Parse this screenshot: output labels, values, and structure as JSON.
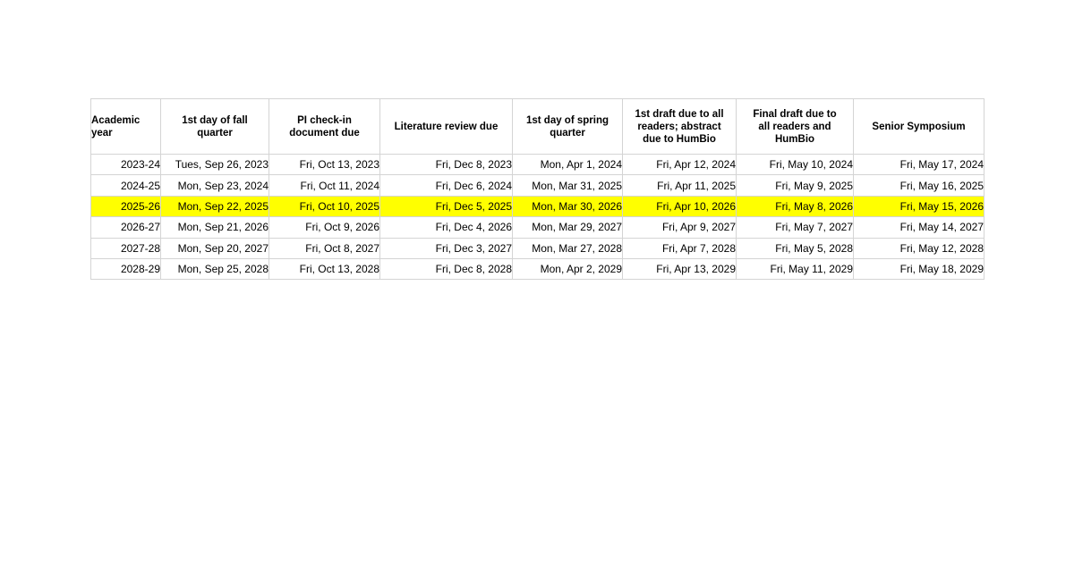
{
  "table": {
    "columns": [
      "Academic year",
      "1st day of fall quarter",
      "PI check-in document due",
      "Literature review due",
      "1st day of spring quarter",
      "1st draft due to all readers; abstract due to HumBio",
      "Final draft due to all readers and HumBio",
      "Senior Symposium"
    ],
    "header_lines": [
      [
        "Academic",
        "year"
      ],
      [
        "1st day of fall",
        "quarter"
      ],
      [
        "PI check-in",
        "document due"
      ],
      [
        "Literature review due"
      ],
      [
        "1st day of spring",
        "quarter"
      ],
      [
        "1st draft due to all",
        "readers; abstract",
        "due to HumBio"
      ],
      [
        "Final draft due to",
        "all readers and",
        "HumBio"
      ],
      [
        "Senior Symposium"
      ]
    ],
    "highlight_color": "#FFFF00",
    "highlighted_row_index": 2,
    "rows": [
      {
        "highlighted": false,
        "cells": [
          "2023-24",
          "Tues, Sep 26, 2023",
          "Fri, Oct 13, 2023",
          "Fri, Dec 8, 2023",
          "Mon, Apr 1, 2024",
          "Fri, Apr 12, 2024",
          "Fri, May 10, 2024",
          "Fri, May 17, 2024"
        ]
      },
      {
        "highlighted": false,
        "cells": [
          "2024-25",
          "Mon, Sep 23, 2024",
          "Fri, Oct 11, 2024",
          "Fri, Dec 6, 2024",
          "Mon, Mar 31, 2025",
          "Fri, Apr 11, 2025",
          "Fri, May 9, 2025",
          "Fri, May 16, 2025"
        ]
      },
      {
        "highlighted": true,
        "cells": [
          "2025-26",
          "Mon, Sep 22, 2025",
          "Fri, Oct 10, 2025",
          "Fri, Dec 5, 2025",
          "Mon, Mar 30, 2026",
          "Fri, Apr 10, 2026",
          "Fri, May 8, 2026",
          "Fri, May 15, 2026"
        ]
      },
      {
        "highlighted": false,
        "cells": [
          "2026-27",
          "Mon, Sep 21, 2026",
          "Fri, Oct 9, 2026",
          "Fri, Dec 4, 2026",
          "Mon, Mar 29, 2027",
          "Fri, Apr 9, 2027",
          "Fri, May 7, 2027",
          "Fri, May 14, 2027"
        ]
      },
      {
        "highlighted": false,
        "cells": [
          "2027-28",
          "Mon, Sep 20, 2027",
          "Fri, Oct 8, 2027",
          "Fri, Dec 3, 2027",
          "Mon, Mar 27, 2028",
          "Fri, Apr 7, 2028",
          "Fri, May 5, 2028",
          "Fri, May 12, 2028"
        ]
      },
      {
        "highlighted": false,
        "cells": [
          "2028-29",
          "Mon, Sep 25, 2028",
          "Fri, Oct 13, 2028",
          "Fri, Dec 8, 2028",
          "Mon, Apr 2, 2029",
          "Fri, Apr 13, 2029",
          "Fri, May 11, 2029",
          "Fri, May 18, 2029"
        ]
      }
    ]
  }
}
